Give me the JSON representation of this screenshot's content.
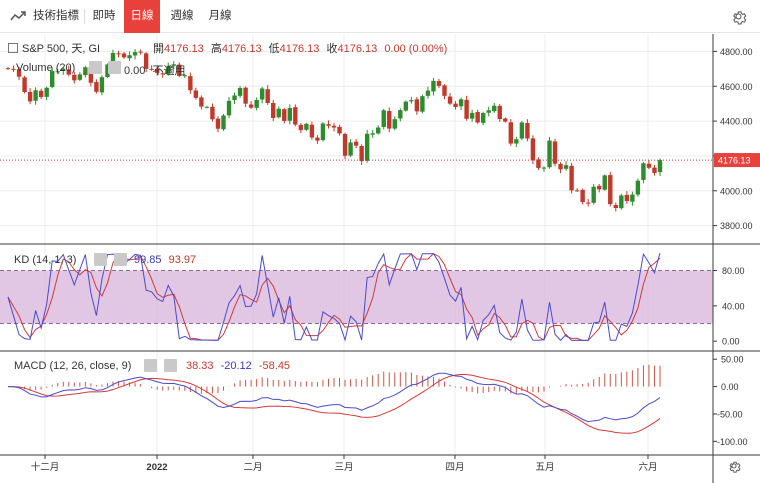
{
  "toolbar": {
    "indicators_label": "技術指標",
    "tabs": [
      "即時",
      "日線",
      "週線",
      "月線"
    ],
    "active_tab": "日線"
  },
  "main_legend": {
    "symbol": "S&P 500, 天, GI",
    "open_label": "開",
    "open": "4176.13",
    "high_label": "高",
    "high": "4176.13",
    "low_label": "低",
    "low": "4176.13",
    "close_label": "收",
    "close": "4176.13",
    "change": "0.00 (0.00%)",
    "volume_label": "Volume (20)",
    "volume_value": "0.00",
    "volume_na": "不適用"
  },
  "price_axis": [
    "4800.00",
    "4600.00",
    "4400.00",
    "4200.00",
    "4000.00",
    "3800.00"
  ],
  "last_price": "4176.13",
  "kd_legend": {
    "label": "KD (14, 1, 3)",
    "k": "99.85",
    "d": "93.97"
  },
  "kd_axis": [
    "80.00",
    "40.00",
    "0.00"
  ],
  "macd_legend": {
    "label": "MACD (12, 26, close, 9)",
    "hist": "38.33",
    "macd": "-20.12",
    "signal": "-58.45"
  },
  "macd_axis": [
    "50.00",
    "0.00",
    "-50.00",
    "-100.00"
  ],
  "time_axis": [
    "十二月",
    "2022",
    "二月",
    "三月",
    "四月",
    "五月",
    "六月"
  ],
  "colors": {
    "up": "#2e8b2e",
    "down": "#c0392b",
    "kd_k": "#4b4bc8",
    "kd_d": "#d23a3a",
    "kd_band": "#d8b4dc",
    "accent": "#e8403a"
  },
  "chart_data": {
    "type": "candlestick",
    "x_range": [
      "2021-11-24",
      "2022-06-03"
    ],
    "ohlc_closes": [
      4701,
      4695,
      4655,
      4567,
      4513,
      4577,
      4538,
      4591,
      4687,
      4686,
      4701,
      4667,
      4634,
      4668,
      4709,
      4620,
      4568,
      4652,
      4725,
      4791,
      4786,
      4766,
      4778,
      4796,
      4793,
      4700,
      4696,
      4677,
      4670,
      4713,
      4726,
      4659,
      4663,
      4577,
      4533,
      4483,
      4482,
      4410,
      4356,
      4432,
      4516,
      4547,
      4590,
      4500,
      4477,
      4521,
      4587,
      4504,
      4418,
      4471,
      4401,
      4475,
      4380,
      4348,
      4384,
      4306,
      4288,
      4386,
      4373,
      4363,
      4329,
      4201,
      4277,
      4259,
      4170,
      4327,
      4330,
      4363,
      4462,
      4357,
      4411,
      4463,
      4512,
      4520,
      4456,
      4543,
      4575,
      4631,
      4602,
      4545,
      4500,
      4481,
      4525,
      4413,
      4447,
      4392,
      4446,
      4462,
      4488,
      4412,
      4397,
      4271,
      4296,
      4392,
      4300,
      4175,
      4131,
      4133,
      4288,
      4155,
      4123,
      4147,
      4002,
      4001,
      3935,
      3930,
      4023,
      4008,
      4088,
      3923,
      3901,
      3973,
      3941,
      3978,
      4058,
      4158,
      4132,
      4102,
      4176
    ],
    "kd_k_end": 99.85,
    "kd_d_end": 93.97,
    "macd_end": -20.12,
    "signal_end": -58.45,
    "hist_end": 38.33,
    "ylim_price": [
      3700,
      4900
    ],
    "ylim_kd": [
      -10,
      110
    ],
    "ylim_macd": [
      -125,
      65
    ]
  }
}
